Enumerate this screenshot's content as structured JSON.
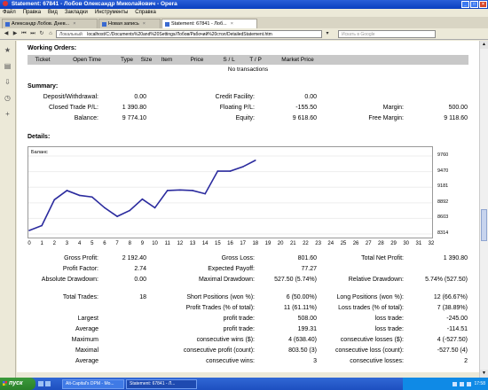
{
  "window": {
    "title": "Statement: 67841 - Лобов Олександр Миколайович - Opera",
    "minimize_icon": "minimize-icon",
    "maximize_icon": "maximize-icon",
    "close_icon": "close-icon"
  },
  "menu": [
    "Файл",
    "Правка",
    "Вид",
    "Закладки",
    "Инструменты",
    "Справка"
  ],
  "tabs": [
    {
      "label": "Александр Лобов. Днев...",
      "active": false
    },
    {
      "label": "Новая запись",
      "active": false
    },
    {
      "label": "Statement: 67841 - Лоб...",
      "active": true
    }
  ],
  "address": {
    "security": "Локальный",
    "url": "localhost/C:/Documents%20and%20Settings/Лобов/Рабочий%20стол/DetailedStatement.htm",
    "search_placeholder": "Искать в Google"
  },
  "working_orders": {
    "heading": "Working Orders:",
    "columns": [
      "Ticket",
      "Open Time",
      "Type",
      "Size",
      "Item",
      "Price",
      "S / L",
      "T / P",
      "Market Price"
    ],
    "empty_text": "No transactions"
  },
  "summary": {
    "heading": "Summary:",
    "deposit_withdrawal": {
      "label": "Deposit/Withdrawal:",
      "value": "0.00"
    },
    "credit_facility": {
      "label": "Credit Facility:",
      "value": "0.00"
    },
    "closed_trade_pl": {
      "label": "Closed Trade P/L:",
      "value": "1 390.80"
    },
    "floating_pl": {
      "label": "Floating P/L:",
      "value": "-155.50"
    },
    "margin": {
      "label": "Margin:",
      "value": "500.00"
    },
    "balance": {
      "label": "Balance:",
      "value": "9 774.10"
    },
    "equity": {
      "label": "Equity:",
      "value": "9 618.60"
    },
    "free_margin": {
      "label": "Free Margin:",
      "value": "9 118.60"
    }
  },
  "details": {
    "heading": "Details:",
    "gross_profit": {
      "label": "Gross Profit:",
      "value": "2 192.40"
    },
    "gross_loss": {
      "label": "Gross Loss:",
      "value": "801.60"
    },
    "total_net_profit": {
      "label": "Total Net Profit:",
      "value": "1 390.80"
    },
    "profit_factor": {
      "label": "Profit Factor:",
      "value": "2.74"
    },
    "expected_payoff": {
      "label": "Expected Payoff:",
      "value": "77.27"
    },
    "absolute_drawdown": {
      "label": "Absolute Drawdown:",
      "value": "0.00"
    },
    "maximal_drawdown": {
      "label": "Maximal Drawdown:",
      "value": "527.50 (5.74%)"
    },
    "relative_drawdown": {
      "label": "Relative Drawdown:",
      "value": "5.74% (527.50)"
    },
    "total_trades": {
      "label": "Total Trades:",
      "value": "18"
    },
    "short_positions": {
      "label": "Short Positions (won %):",
      "value": "6 (50.00%)"
    },
    "long_positions": {
      "label": "Long Positions (won %):",
      "value": "12 (66.67%)"
    },
    "profit_trades": {
      "label": "Profit Trades (% of total):",
      "value": "11 (61.11%)"
    },
    "loss_trades": {
      "label": "Loss trades (% of total):",
      "value": "7 (38.89%)"
    },
    "largest": {
      "label": "Largest",
      "profit_label": "profit trade:",
      "profit_value": "508.00",
      "loss_label": "loss trade:",
      "loss_value": "-245.00"
    },
    "average": {
      "label": "Average",
      "profit_label": "profit trade:",
      "profit_value": "199.31",
      "loss_label": "loss trade:",
      "loss_value": "-114.51"
    },
    "maximum": {
      "label": "Maximum",
      "profit_label": "consecutive wins ($):",
      "profit_value": "4 (638.40)",
      "loss_label": "consecutive losses ($):",
      "loss_value": "4 (-527.50)"
    },
    "maximal": {
      "label": "Maximal",
      "profit_label": "consecutive profit (count):",
      "profit_value": "803.50 (3)",
      "loss_label": "consecutive loss (count):",
      "loss_value": "-527.50 (4)"
    },
    "average2": {
      "label": "Average",
      "profit_label": "consecutive wins:",
      "profit_value": "3",
      "loss_label": "consecutive losses:",
      "loss_value": "2"
    }
  },
  "chart_data": {
    "type": "line",
    "series": [
      {
        "name": "Баланс",
        "color": "#2b2b9e"
      }
    ],
    "x": [
      0,
      1,
      2,
      3,
      4,
      5,
      6,
      7,
      8,
      9,
      10,
      11,
      12,
      13,
      14,
      15,
      16,
      17,
      18
    ],
    "values": [
      8380,
      8470,
      8950,
      9120,
      9030,
      9000,
      8800,
      8640,
      8750,
      8960,
      8800,
      9120,
      9130,
      9120,
      9060,
      9480,
      9480,
      9560,
      9680
    ],
    "xticks": [
      "0",
      "1",
      "2",
      "3",
      "4",
      "5",
      "6",
      "7",
      "8",
      "9",
      "10",
      "11",
      "12",
      "13",
      "14",
      "15",
      "16",
      "17",
      "18",
      "19",
      "20",
      "21",
      "22",
      "23",
      "24",
      "25",
      "26",
      "27",
      "28",
      "29",
      "30",
      "31",
      "32"
    ],
    "yticks": [
      "9760",
      "9470",
      "9181",
      "8892",
      "8603",
      "8314"
    ],
    "xlim": [
      0,
      32
    ],
    "ylim": [
      8314,
      9760
    ]
  },
  "taskbar": {
    "start": "пуск",
    "tasks": [
      "Alt-Capital's DPM - Mo...",
      "Statement: 67841 - Л..."
    ],
    "clock": "17:58"
  }
}
